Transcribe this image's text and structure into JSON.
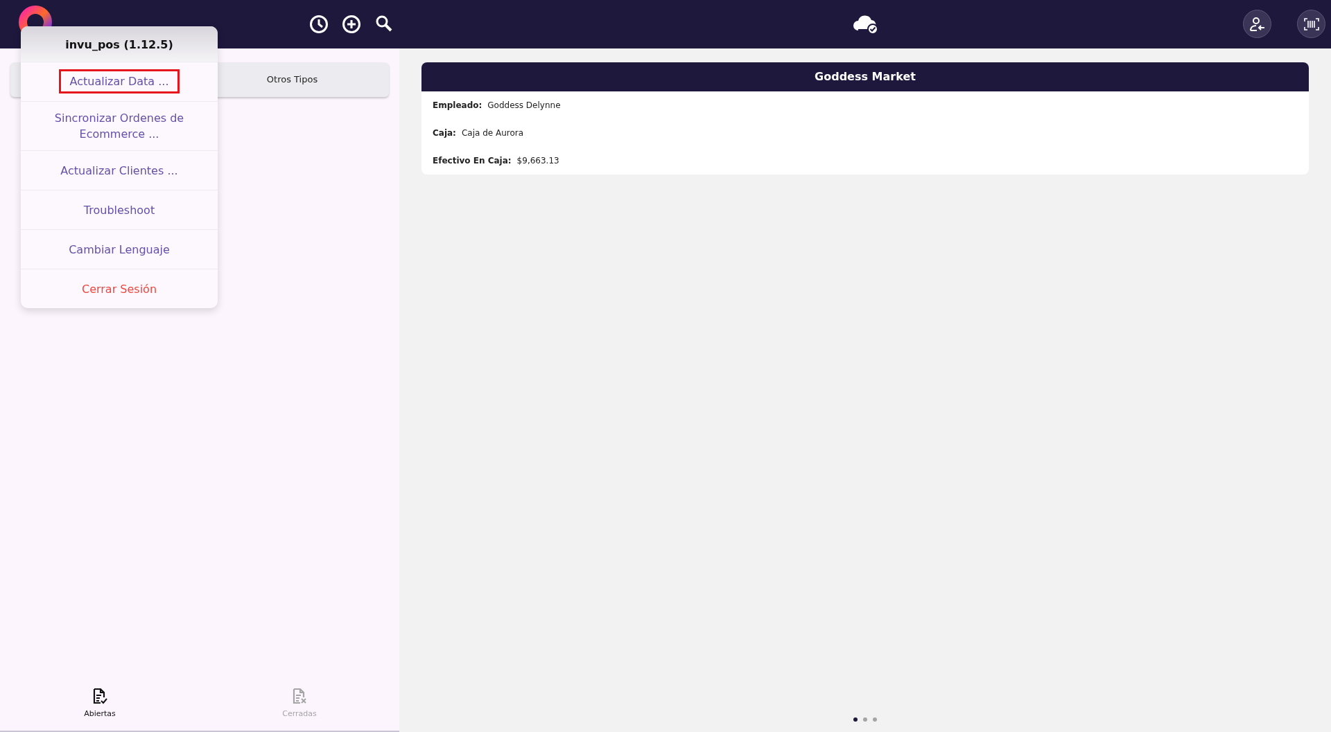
{
  "tabs": [
    {
      "label": "Otros Tipos",
      "selected": false
    }
  ],
  "menu": {
    "title": "invu_pos (1.12.5)",
    "items": [
      {
        "label": "Actualizar Data ...",
        "kind": "normal",
        "highlighted": true
      },
      {
        "label": "Sincronizar Ordenes de Ecommerce ...",
        "kind": "normal",
        "highlighted": false
      },
      {
        "label": "Actualizar Clientes ...",
        "kind": "normal",
        "highlighted": false
      },
      {
        "label": "Troubleshoot",
        "kind": "normal",
        "highlighted": false
      },
      {
        "label": "Cambiar Lenguaje",
        "kind": "normal",
        "highlighted": false
      },
      {
        "label": "Cerrar Sesión",
        "kind": "danger",
        "highlighted": false
      }
    ]
  },
  "card": {
    "title": "Goddess Market",
    "fields": [
      {
        "label": "Empleado:",
        "value": "Goddess Delynne"
      },
      {
        "label": "Caja:",
        "value": "Caja de Aurora"
      },
      {
        "label": "Efectivo En Caja:",
        "value": "$9,663.13"
      }
    ]
  },
  "bottom_nav": [
    {
      "label": "Abiertas",
      "selected": true,
      "kind": "open"
    },
    {
      "label": "Cerradas",
      "selected": false,
      "kind": "closed"
    }
  ],
  "pager": [
    {
      "selected": true
    },
    {
      "selected": false
    },
    {
      "selected": false
    }
  ]
}
